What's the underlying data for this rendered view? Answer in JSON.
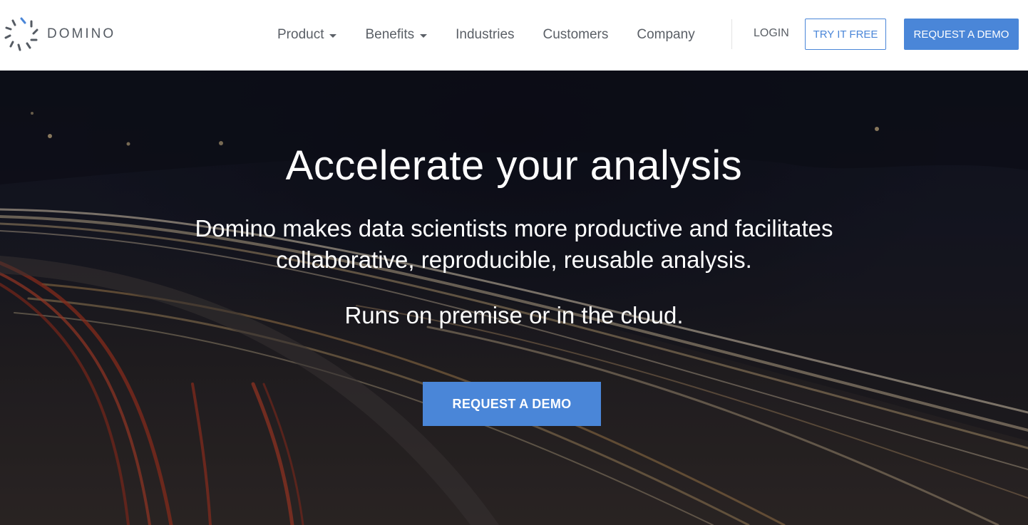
{
  "brand": {
    "name": "DOMINO",
    "logo_icon": "domino-logo-icon",
    "accent": "#4a86d8"
  },
  "nav": {
    "items": [
      {
        "label": "Product",
        "has_dropdown": true
      },
      {
        "label": "Benefits",
        "has_dropdown": true
      },
      {
        "label": "Industries",
        "has_dropdown": false
      },
      {
        "label": "Customers",
        "has_dropdown": false
      },
      {
        "label": "Company",
        "has_dropdown": false
      }
    ],
    "login": "LOGIN",
    "try_free": "TRY IT FREE",
    "request_demo": "REQUEST A DEMO"
  },
  "hero": {
    "title": "Accelerate your analysis",
    "subtitle_line1": "Domino makes data scientists more productive and facilitates",
    "subtitle_line2": "collaborative, reproducible, reusable analysis.",
    "runs": "Runs on premise or in the cloud.",
    "cta": "REQUEST A DEMO",
    "background": "night-highway-light-trails"
  }
}
